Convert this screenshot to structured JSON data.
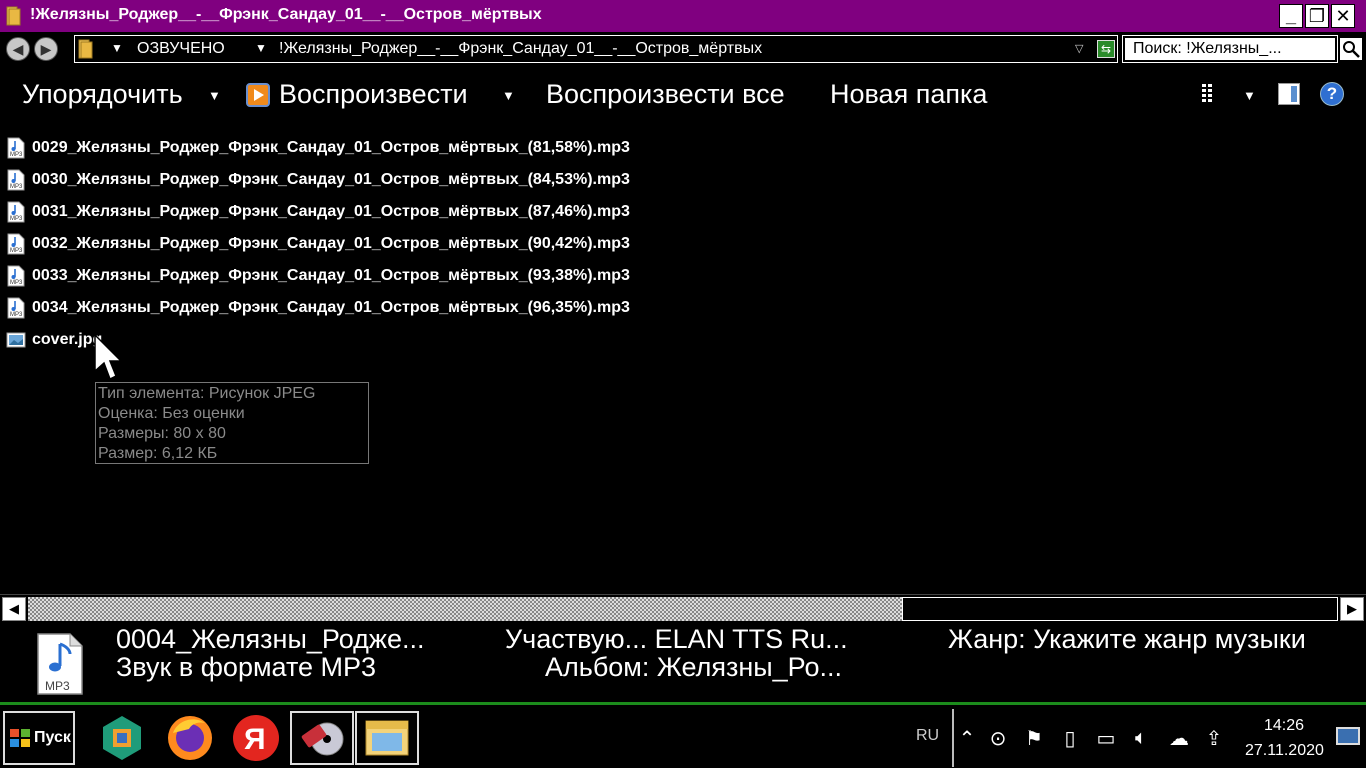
{
  "window": {
    "title": "!Желязны_Роджер__-__Фрэнк_Сандау_01__-__Остров_мёртвых",
    "min_glyph": "_",
    "max_glyph": "❐",
    "close_glyph": "✕"
  },
  "address": {
    "crumbs": [
      "ОЗВУЧЕНО",
      "!Желязны_Роджер__-__Фрэнк_Сандау_01__-__Остров_мёртвых"
    ],
    "search_text": "Поиск: !Желязны_..."
  },
  "toolbar": {
    "organize": "Упорядочить",
    "play": "Воспроизвести",
    "play_all": "Воспроизвести все",
    "new_folder": "Новая папка",
    "help_glyph": "?"
  },
  "files": [
    {
      "name": "0029_Желязны_Роджер_Фрэнк_Сандау_01_Остров_мёртвых_(81,58%).mp3",
      "type": "mp3"
    },
    {
      "name": "0030_Желязны_Роджер_Фрэнк_Сандау_01_Остров_мёртвых_(84,53%).mp3",
      "type": "mp3"
    },
    {
      "name": "0031_Желязны_Роджер_Фрэнк_Сандау_01_Остров_мёртвых_(87,46%).mp3",
      "type": "mp3"
    },
    {
      "name": "0032_Желязны_Роджер_Фрэнк_Сандау_01_Остров_мёртвых_(90,42%).mp3",
      "type": "mp3"
    },
    {
      "name": "0033_Желязны_Роджер_Фрэнк_Сандау_01_Остров_мёртвых_(93,38%).mp3",
      "type": "mp3"
    },
    {
      "name": "0034_Желязны_Роджер_Фрэнк_Сандау_01_Остров_мёртвых_(96,35%).mp3",
      "type": "mp3"
    },
    {
      "name": "cover.jpg",
      "type": "jpg"
    }
  ],
  "tooltip": {
    "lines": [
      "Тип элемента: Рисунок JPEG",
      "Оценка: Без оценки",
      "Размеры: 80 x 80",
      "Размер: 6,12 КБ"
    ]
  },
  "details": {
    "name": "0004_Желязны_Родже...",
    "type": "Звук в формате MP3",
    "participants": "Участвую... ELAN TTS Ru...",
    "album": "Альбом: Желязны_Ро...",
    "genre": "Жанр: Укажите жанр музыки",
    "icon_label": "MP3"
  },
  "taskbar": {
    "start_label": "Пуск",
    "yandex_letter": "Я",
    "lang": "RU",
    "time": "14:26",
    "date": "27.11.2020"
  },
  "colors": {
    "titlebar": "#800080",
    "taskbar_accent": "#1c8c1c",
    "tooltip_text": "#8a8a8a"
  },
  "icons": {
    "title": "folder-icon",
    "back": "back-arrow-icon",
    "forward": "forward-arrow-icon",
    "search": "magnifier-icon",
    "play": "play-icon",
    "views": "view-mode-icon",
    "pane": "preview-pane-icon",
    "help": "help-icon"
  }
}
